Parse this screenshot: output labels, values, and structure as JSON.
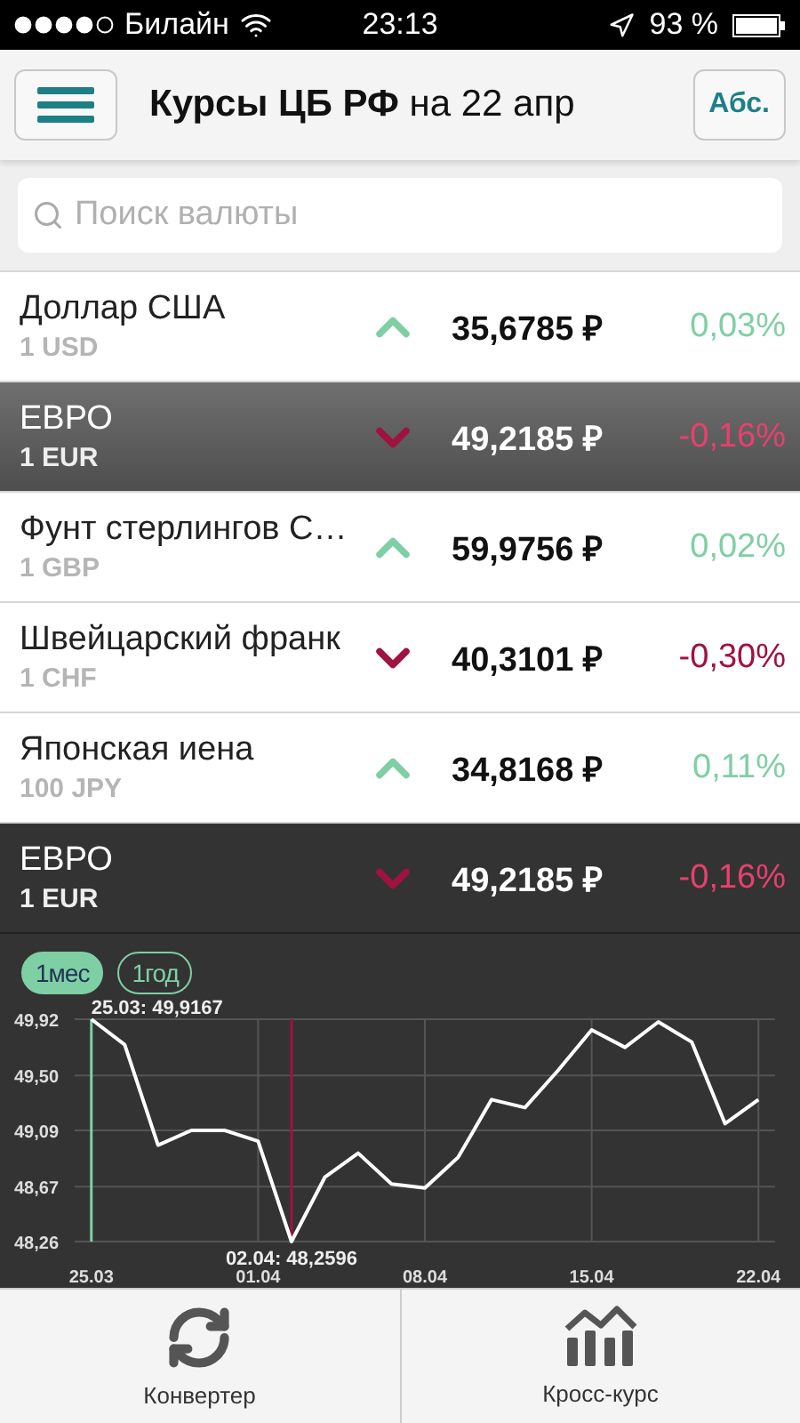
{
  "status_bar": {
    "carrier": "Билайн",
    "time": "23:13",
    "battery": "93 %"
  },
  "header": {
    "title": "**Курсы ЦБ РФ** на 22 апр",
    "mode_button": "Абс."
  },
  "search": {
    "placeholder": "Поиск валюты"
  },
  "rates": [
    {
      "name": "Доллар США",
      "unit": "1 USD",
      "kind": "up",
      "rate": "35,6785 ₽",
      "change": "0,03%",
      "selected": false
    },
    {
      "name": "ЕВРО",
      "unit": "1 EUR",
      "kind": "down",
      "rate": "49,2185 ₽",
      "change": "-0,16%",
      "selected": true
    },
    {
      "name": "Фунт стерлингов С…",
      "unit": "1 GBP",
      "kind": "up",
      "rate": "59,9756 ₽",
      "change": "0,02%",
      "selected": false
    },
    {
      "name": "Швейцарский франк",
      "unit": "1 CHF",
      "kind": "down",
      "rate": "40,3101 ₽",
      "change": "-0,30%",
      "selected": false
    },
    {
      "name": "Японская иена",
      "unit": "100 JPY",
      "kind": "up",
      "rate": "34,8168 ₽",
      "change": "0,11%",
      "selected": false
    }
  ],
  "detail": {
    "name": "ЕВРО",
    "unit": "1 EUR",
    "kind": "down",
    "rate": "49,2185 ₽",
    "change": "-0,16%",
    "periods": [
      {
        "label": "1мес",
        "selected": true
      },
      {
        "label": "1год",
        "selected": false
      }
    ],
    "markers": [
      {
        "kind": "max",
        "label": "25.03: 49,9167"
      },
      {
        "kind": "min",
        "label": "02.04: 48,2596"
      }
    ],
    "chart_data": {
      "type": "line",
      "categories": [
        "25.03",
        null,
        null,
        null,
        null,
        "01.04",
        null,
        null,
        null,
        null,
        "08.04",
        null,
        null,
        null,
        null,
        "15.04",
        null,
        null,
        null,
        null,
        "22.04"
      ],
      "series": [
        {
          "color": "#ffffff",
          "values": [
            49.92,
            49.73,
            48.98,
            49.09,
            49.09,
            49.01,
            48.26,
            48.74,
            48.92,
            48.69,
            48.66,
            48.89,
            49.32,
            49.26,
            49.54,
            49.84,
            49.71,
            49.9,
            49.75,
            49.14,
            49.32
          ]
        }
      ],
      "ylim": [
        48.26,
        49.92
      ],
      "grid": true,
      "yticks": [
        {
          "value": 48.26,
          "label": "48,26"
        },
        {
          "value": 48.67,
          "label": "48,67"
        },
        {
          "value": 49.09,
          "label": "49,09"
        },
        {
          "value": 49.5,
          "label": "49,50"
        },
        {
          "value": 49.92,
          "label": "49,92"
        }
      ]
    }
  },
  "tab_bar": [
    {
      "kind": "converter",
      "label": "Конвертер"
    },
    {
      "kind": "cross",
      "label": "Кросс-курс"
    }
  ]
}
